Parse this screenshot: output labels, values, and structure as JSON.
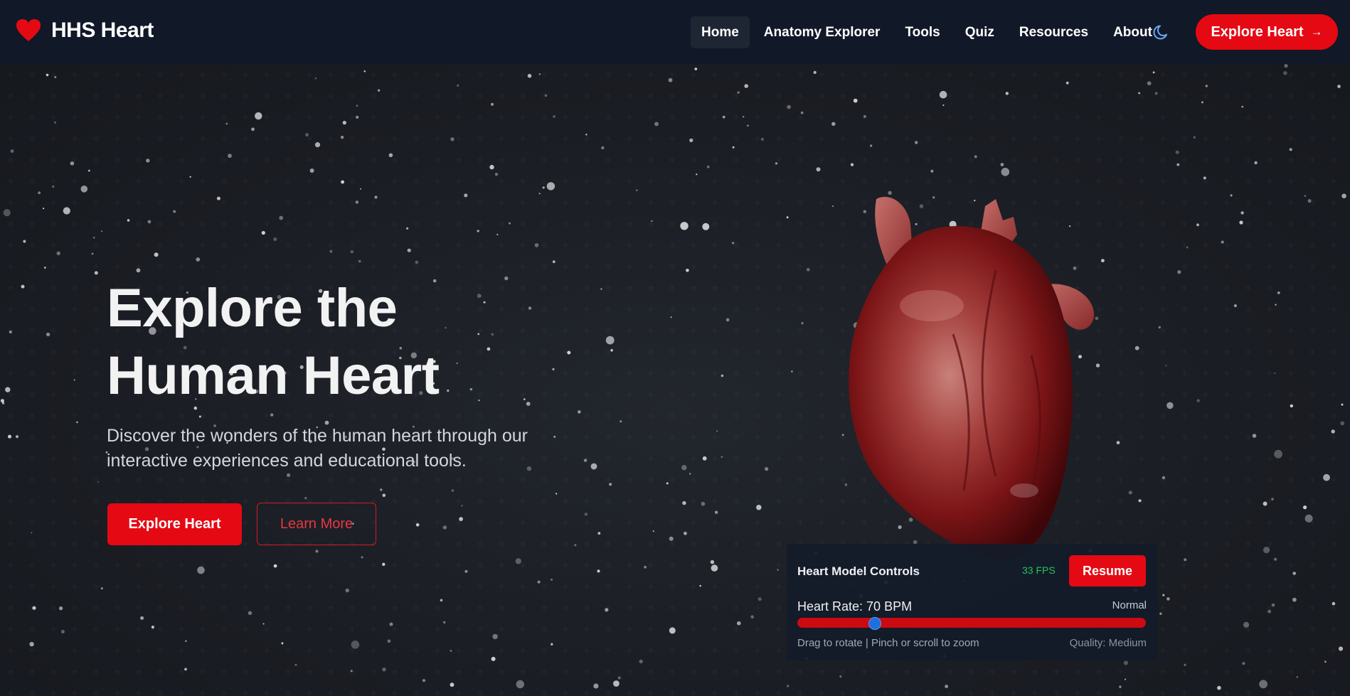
{
  "brand": {
    "name": "HHS Heart",
    "icon": "heart-icon",
    "accent": "#e50914"
  },
  "nav": {
    "links": [
      {
        "label": "Home",
        "active": true
      },
      {
        "label": "Anatomy Explorer",
        "active": false
      },
      {
        "label": "Tools",
        "active": false
      },
      {
        "label": "Quiz",
        "active": false
      },
      {
        "label": "Resources",
        "active": false
      },
      {
        "label": "About",
        "active": false
      }
    ],
    "theme_toggle_icon": "moon-icon",
    "cta_label": "Explore Heart",
    "cta_icon": "arrow-right-icon"
  },
  "hero": {
    "title_line1": "Explore the",
    "title_line2": "Human Heart",
    "subtitle": "Discover the wonders of the human heart through our interactive experiences and educational tools.",
    "primary_button": "Explore Heart",
    "secondary_button": "Learn More"
  },
  "controls": {
    "title": "Heart Model Controls",
    "fps": "33 FPS",
    "resume_label": "Resume",
    "heart_rate_label": "Heart Rate: 70 BPM",
    "heart_rate_status": "Normal",
    "heart_rate_fraction": 0.22,
    "hint": "Drag to rotate | Pinch or scroll to zoom",
    "quality": "Quality: Medium"
  },
  "colors": {
    "background": "#1a1d23",
    "navbar": "#111827",
    "accent_red": "#e50914",
    "fps_green": "#22c55e",
    "slider_thumb": "#1d6fe0"
  }
}
